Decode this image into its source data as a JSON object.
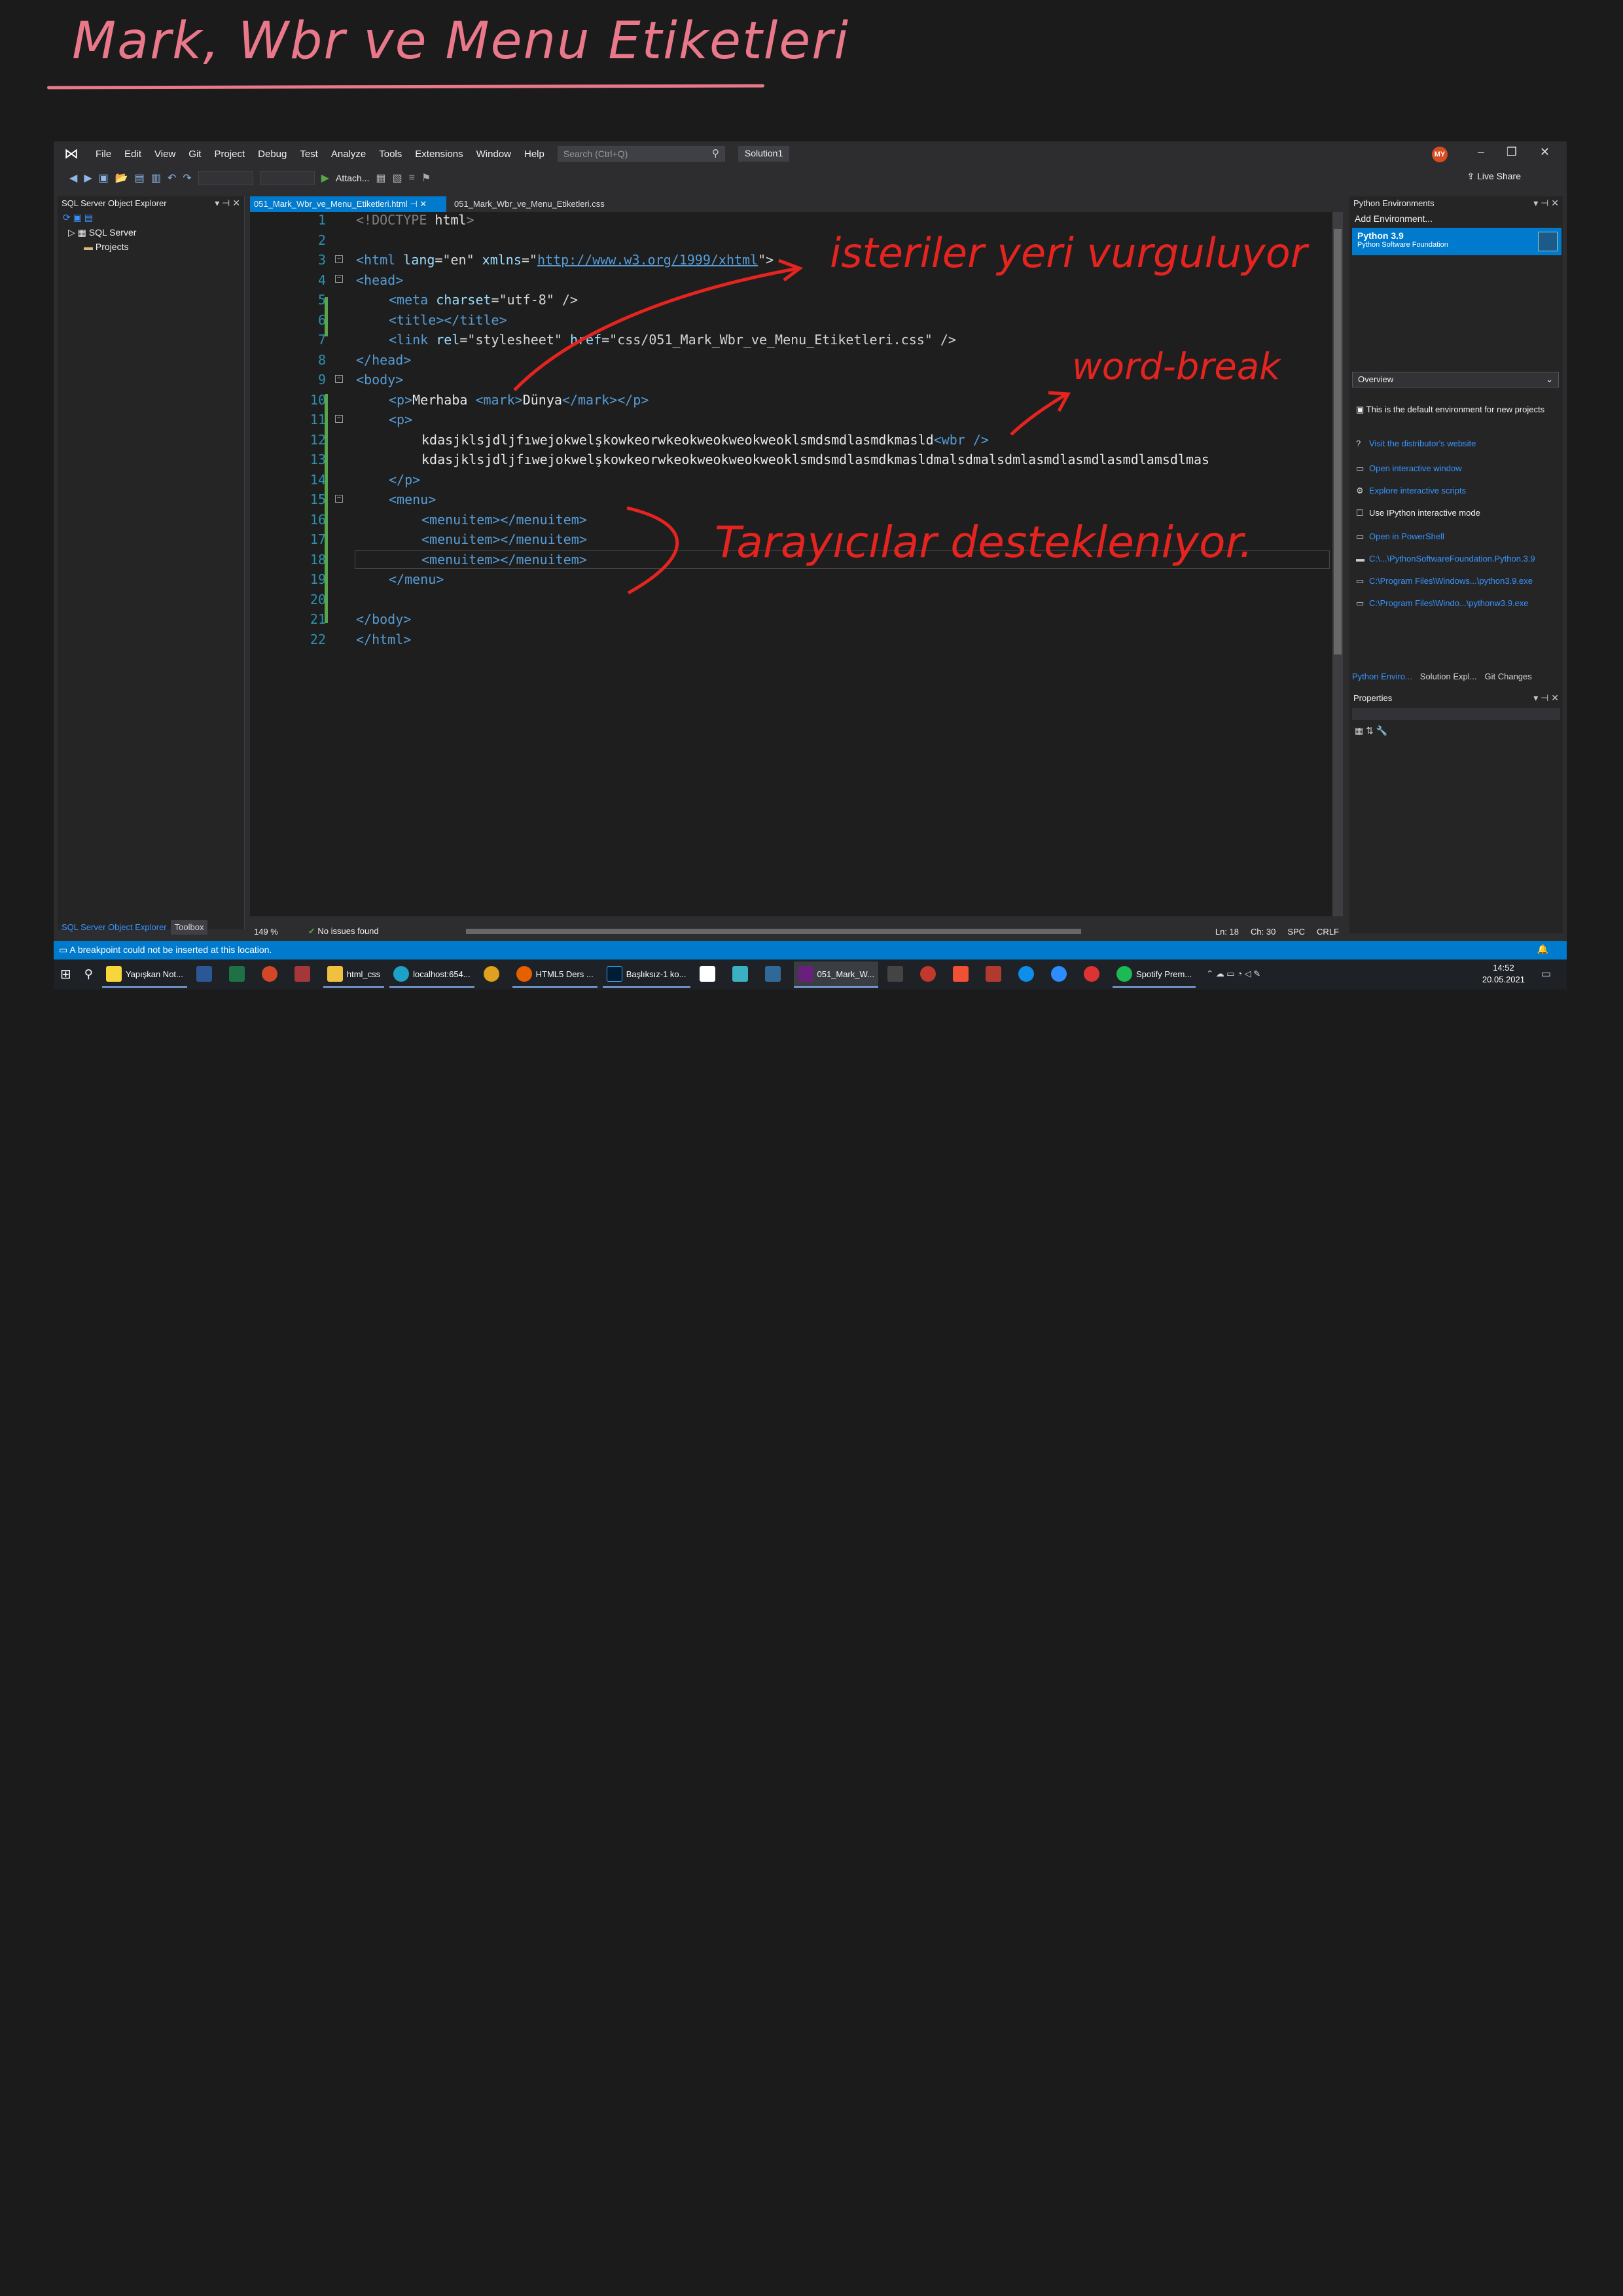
{
  "annotations": {
    "title": "Mark, Wbr ve Menu   Etiketleri",
    "note1": "isteriler yeri vurguluyor",
    "note2": "word-break",
    "note3": "Tarayıcılar destekleniyor."
  },
  "menubar": {
    "items": [
      "File",
      "Edit",
      "View",
      "Git",
      "Project",
      "Debug",
      "Test",
      "Analyze",
      "Tools",
      "Extensions",
      "Window",
      "Help"
    ],
    "search_placeholder": "Search (Ctrl+Q)",
    "solution": "Solution1",
    "avatar": "MY",
    "attach": "Attach...",
    "live_share": "Live Share"
  },
  "left_pane": {
    "title": "SQL Server Object Explorer",
    "tree": [
      "SQL Server",
      "Projects"
    ],
    "bottom_tabs": [
      "SQL Server Object Explorer",
      "Toolbox"
    ]
  },
  "tabs": [
    "051_Mark_Wbr_ve_Menu_Etiketleri.html",
    "051_Mark_Wbr_ve_Menu_Etiketleri.css"
  ],
  "code": {
    "line_numbers": [
      "1",
      "2",
      "3",
      "4",
      "5",
      "6",
      "7",
      "8",
      "9",
      "10",
      "11",
      "12",
      "13",
      "14",
      "15",
      "16",
      "17",
      "18",
      "19",
      "20",
      "21",
      "22"
    ],
    "l1a": "<!DOCTYPE ",
    "l1b": "html",
    "l1c": ">",
    "l3a": "<html ",
    "l3b": "lang",
    "l3c": "=\"en\" ",
    "l3d": "xmlns",
    "l3e": "=\"",
    "l3f": "http://www.w3.org/1999/xhtml",
    "l3g": "\">",
    "l4": "<head>",
    "l5a": "<meta ",
    "l5b": "charset",
    "l5c": "=\"utf-8\" />",
    "l6": "<title></title>",
    "l7a": "<link ",
    "l7b": "rel",
    "l7c": "=\"stylesheet\" ",
    "l7d": "href",
    "l7e": "=\"css/051_Mark_Wbr_ve_Menu_Etiketleri.css\" />",
    "l8": "</head>",
    "l9": "<body>",
    "l10a": "<p>",
    "l10b": "Merhaba ",
    "l10c": "<mark>",
    "l10d": "Dünya",
    "l10e": "</mark></p>",
    "l11": "<p>",
    "l12a": "kdasjklsjdljfıwejokwelşkowkeorwkeokweokweokweoklsmdsmdlasmdkmasld",
    "l12b": "<wbr />",
    "l13": "kdasjklsjdljfıwejokwelşkowkeorwkeokweokweokweoklsmdsmdlasmdkmasldmalsdmalsdmlasmdlasmdlasmdlamsdlmas",
    "l14": "</p>",
    "l15": "<menu>",
    "l16": "<menuitem></menuitem>",
    "l17": "<menuitem></menuitem>",
    "l18": "<menuitem></menuitem>",
    "l19": "</menu>",
    "l21": "</body>",
    "l22": "</html>"
  },
  "editor_status": {
    "zoom": "149 %",
    "issues": "No issues found",
    "ln": "Ln: 18",
    "ch": "Ch: 30",
    "spc": "SPC",
    "crlf": "CRLF"
  },
  "right_pane": {
    "title": "Python Environments",
    "add_env": "Add Environment...",
    "env_name": "Python 3.9",
    "env_sub": "Python Software Foundation",
    "overview": "Overview",
    "default_note": "This is the default environment for new projects",
    "links": [
      "Visit the distributor's website",
      "Open interactive window",
      "Explore interactive scripts",
      "Use IPython interactive mode",
      "Open in PowerShell",
      "C:\\...\\PythonSoftwareFoundation.Python.3.9",
      "C:\\Program Files\\Windows...\\python3.9.exe",
      "C:\\Program Files\\Windo...\\pythonw3.9.exe"
    ],
    "bottom_tabs": [
      "Python Enviro...",
      "Solution Expl...",
      "Git Changes"
    ],
    "properties": "Properties"
  },
  "status_bar": "A breakpoint could not be inserted at this location.",
  "taskbar": {
    "items": [
      "Yapışkan Not...",
      "html_css",
      "localhost:654...",
      "HTML5 Ders ...",
      "Başlıksız-1 ko...",
      "051_Mark_W...",
      "Spotify Prem..."
    ],
    "time": "14:52",
    "date": "20.05.2021"
  },
  "colors": {
    "accent": "#007acc",
    "annotation": "#e52420",
    "title_ink": "#e8788a"
  }
}
